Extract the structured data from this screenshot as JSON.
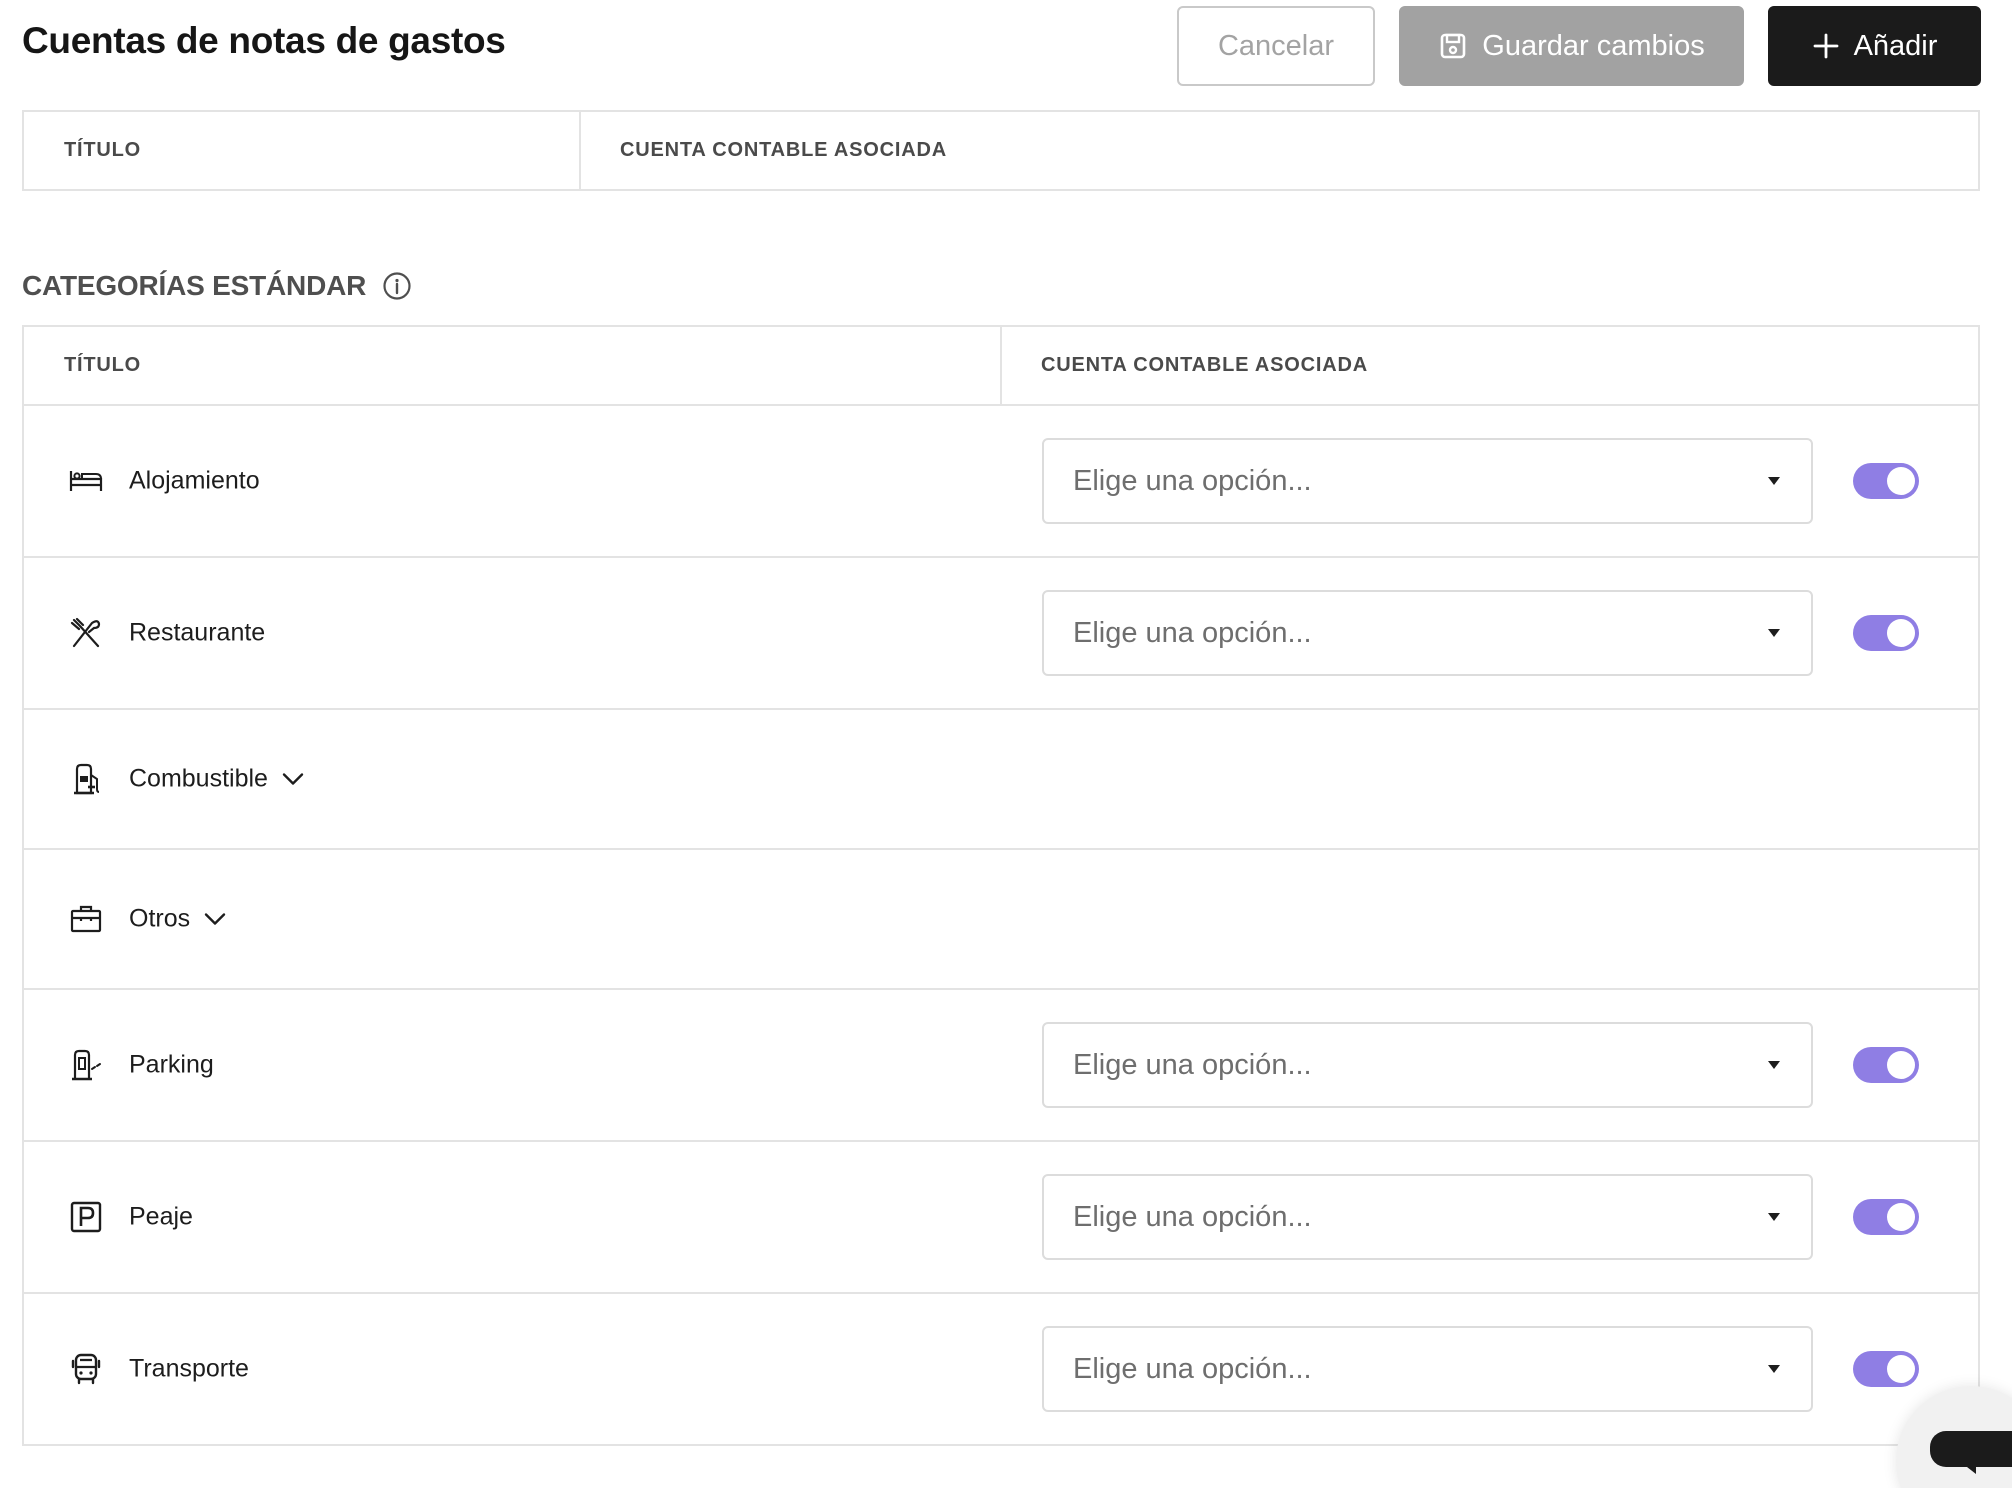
{
  "header": {
    "title": "Cuentas de notas de gastos",
    "cancel_label": "Cancelar",
    "save_label": "Guardar cambios",
    "add_label": "Añadir"
  },
  "custom_table": {
    "col_title": "TÍTULO",
    "col_account": "CUENTA CONTABLE ASOCIADA"
  },
  "standard_section": {
    "heading": "CATEGORÍAS ESTÁNDAR",
    "col_title": "TÍTULO",
    "col_account": "CUENTA CONTABLE ASOCIADA",
    "rows": [
      {
        "label": "Alojamiento",
        "icon": "bed-icon",
        "placeholder": "Elige una opción...",
        "enabled": true
      },
      {
        "label": "Restaurante",
        "icon": "cutlery-icon",
        "placeholder": "Elige una opción...",
        "enabled": true
      },
      {
        "label": "Combustible",
        "icon": "fuel-pump-icon",
        "expandable": true
      },
      {
        "label": "Otros",
        "icon": "briefcase-icon",
        "expandable": true
      },
      {
        "label": "Parking",
        "icon": "parking-meter-icon",
        "placeholder": "Elige una opción...",
        "enabled": true
      },
      {
        "label": "Peaje",
        "icon": "parking-sign-icon",
        "placeholder": "Elige una opción...",
        "enabled": true
      },
      {
        "label": "Transporte",
        "icon": "bus-icon",
        "placeholder": "Elige una opción...",
        "enabled": true
      }
    ]
  },
  "colors": {
    "toggle_on": "#8f7ee4",
    "primary_button": "#1b1b1b",
    "save_button_disabled": "#a2a2a2"
  }
}
